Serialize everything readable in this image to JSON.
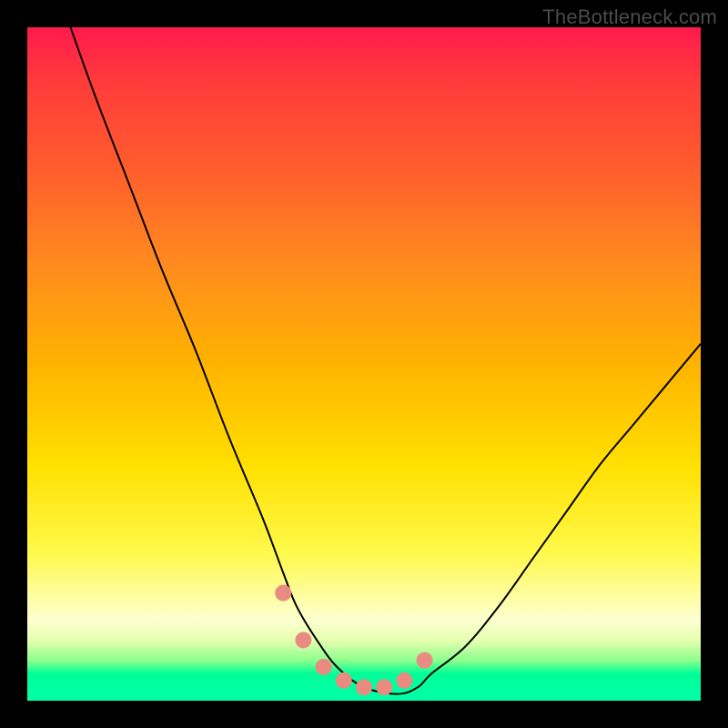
{
  "watermark": "TheBottleneck.com",
  "chart_data": {
    "type": "line",
    "title": "",
    "xlabel": "",
    "ylabel": "",
    "xlim": [
      0,
      100
    ],
    "ylim": [
      0,
      100
    ],
    "grid": false,
    "legend": false,
    "series": [
      {
        "name": "bottleneck-curve",
        "x": [
          0,
          5,
          10,
          15,
          20,
          25,
          30,
          35,
          38,
          40,
          43,
          46,
          50,
          55,
          58,
          60,
          65,
          70,
          75,
          80,
          85,
          90,
          95,
          100
        ],
        "y": [
          118,
          104,
          90,
          77,
          64,
          52,
          39,
          27,
          19,
          14,
          9,
          5,
          2,
          1,
          2,
          4,
          8,
          14,
          21,
          28,
          35,
          41,
          47,
          53
        ]
      },
      {
        "name": "highlight-points",
        "x": [
          38,
          41,
          44,
          47,
          50,
          53,
          56,
          59
        ],
        "y": [
          16,
          9,
          5,
          3,
          2,
          2,
          3,
          6
        ]
      }
    ],
    "colors": {
      "curve": "#000000",
      "highlight": "#e98b80",
      "gradient_top": "#ff1a4d",
      "gradient_mid": "#ffe000",
      "gradient_bottom": "#00ffa8"
    }
  }
}
